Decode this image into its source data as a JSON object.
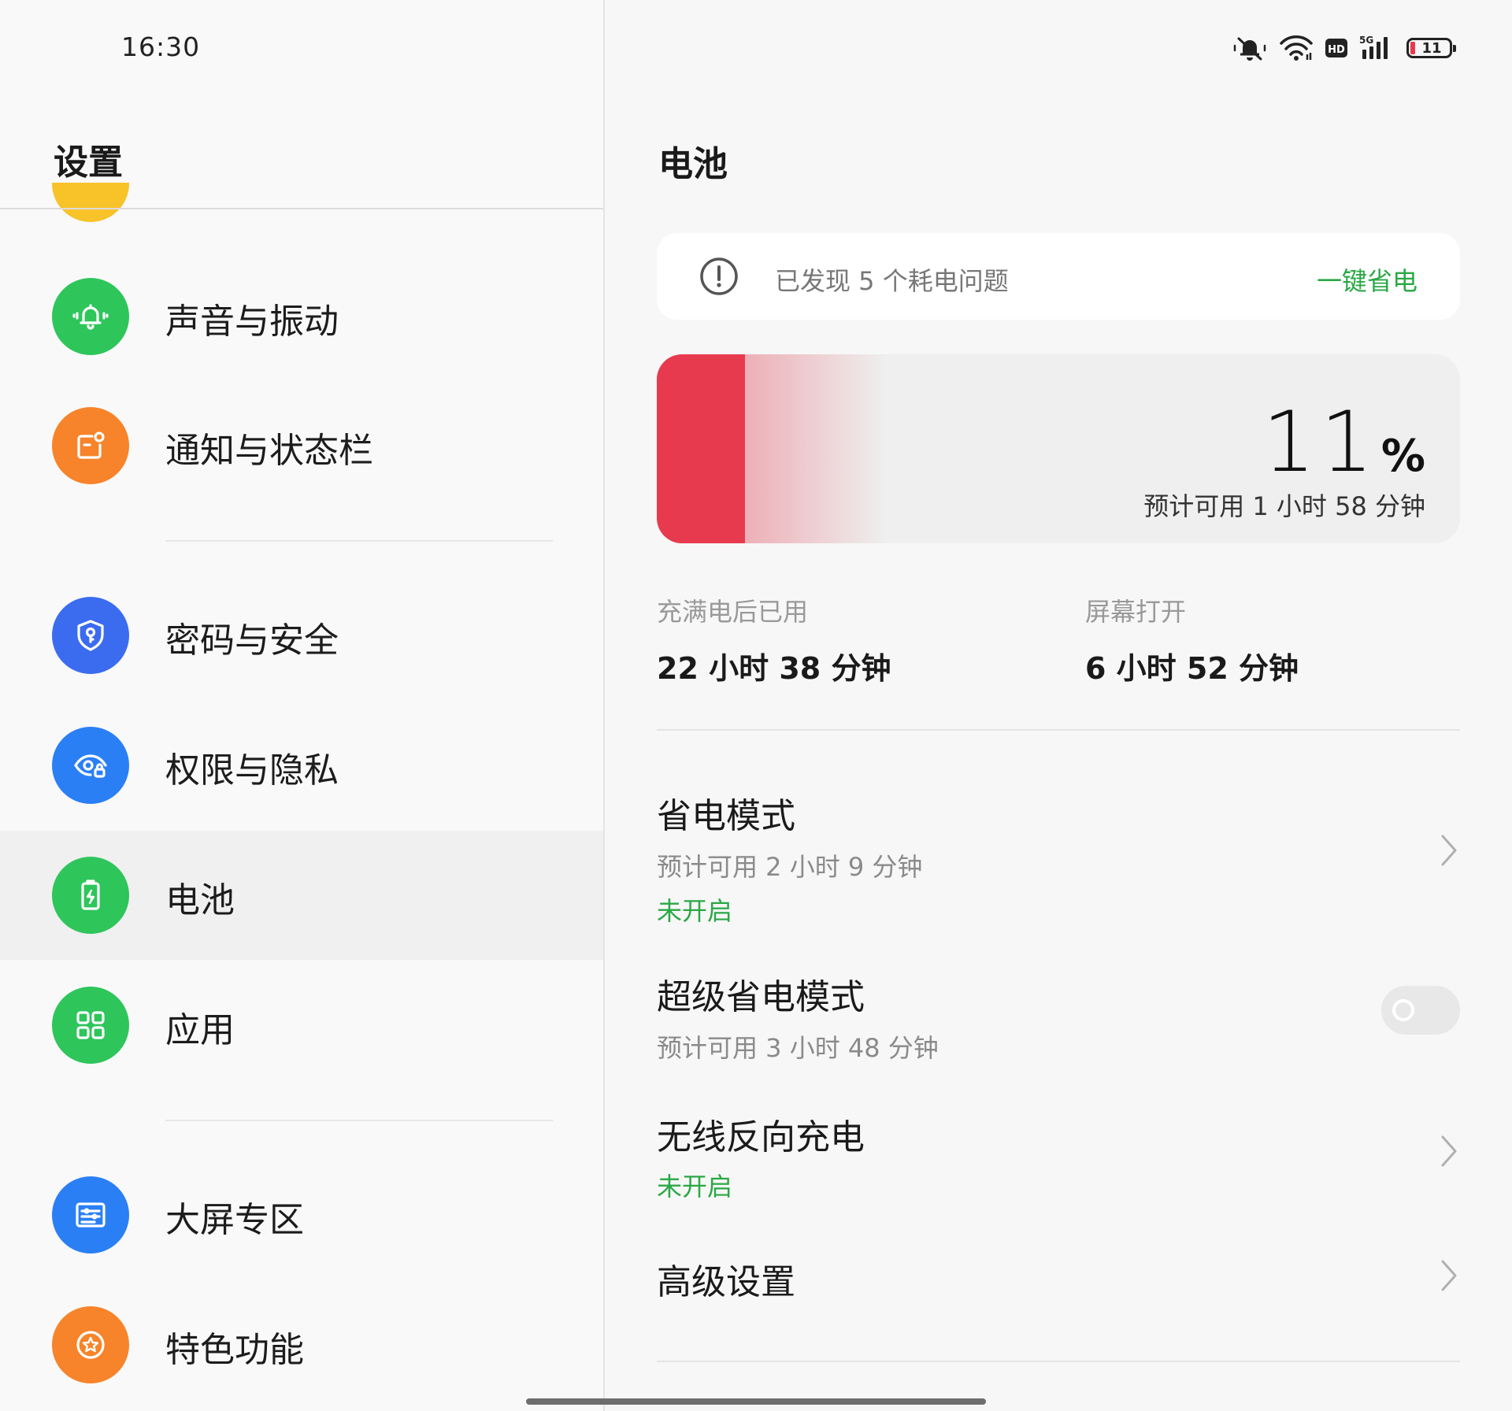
{
  "status_bar": {
    "time": "16:30",
    "network": "5G",
    "hd_badge": "HD",
    "battery_level": "11",
    "icons": [
      "mute-bell-icon",
      "wifi-icon",
      "hd-icon",
      "signal-icon",
      "battery-icon"
    ]
  },
  "left": {
    "title": "设置",
    "items": [
      {
        "label": "声音与振动",
        "icon": "bell-vibrate-icon",
        "color": "#2ec55b"
      },
      {
        "label": "通知与状态栏",
        "icon": "notification-icon",
        "color": "#f7842a"
      },
      {
        "label": "密码与安全",
        "icon": "shield-key-icon",
        "color": "#3b6cf0"
      },
      {
        "label": "权限与隐私",
        "icon": "eye-lock-icon",
        "color": "#2b7ff5"
      },
      {
        "label": "电池",
        "icon": "battery-charge-icon",
        "color": "#2ec55b",
        "selected": true
      },
      {
        "label": "应用",
        "icon": "apps-grid-icon",
        "color": "#2ec55b"
      },
      {
        "label": "大屏专区",
        "icon": "large-screen-icon",
        "color": "#2b7ff5"
      },
      {
        "label": "特色功能",
        "icon": "star-badge-icon",
        "color": "#f7842a"
      }
    ]
  },
  "right": {
    "title": "电池",
    "alert": {
      "icon": "exclamation-circle-icon",
      "text": "已发现 5 个耗电问题",
      "action": "一键省电"
    },
    "battery": {
      "percent_value": "11",
      "percent_symbol": "%",
      "level_fraction": 0.11,
      "estimate": "预计可用 1 小时 58 分钟",
      "color": "#e83a4e"
    },
    "stats": [
      {
        "label": "充满电后已用",
        "value": "22 小时 38 分钟"
      },
      {
        "label": "屏幕打开",
        "value": "6 小时 52 分钟"
      }
    ],
    "settings": {
      "power_saving": {
        "title": "省电模式",
        "subtitle": "预计可用 2 小时 9 分钟",
        "state": "未开启"
      },
      "super_power_saving": {
        "title": "超级省电模式",
        "subtitle": "预计可用 3 小时 48 分钟",
        "toggle_on": false
      },
      "wireless_reverse_charging": {
        "title": "无线反向充电",
        "state": "未开启"
      },
      "advanced": {
        "title": "高级设置"
      }
    },
    "accent_color": "#2aa845"
  }
}
